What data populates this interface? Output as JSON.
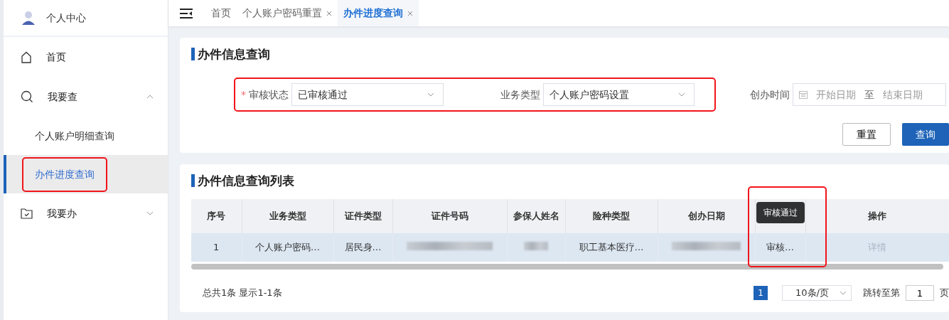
{
  "sidebar": {
    "user": {
      "name": "个人中心"
    },
    "items": [
      {
        "label": "首页"
      },
      {
        "label": "我要查",
        "expanded": true,
        "children": [
          {
            "label": "个人账户明细查询",
            "selected": false,
            "annotated": false
          },
          {
            "label": "办件进度查询",
            "selected": true,
            "annotated": true
          }
        ]
      },
      {
        "label": "我要办",
        "expanded": false
      }
    ]
  },
  "tabs": [
    {
      "label": "首页",
      "selected": false,
      "closable": false
    },
    {
      "label": "个人账户密码重置",
      "selected": false,
      "closable": true
    },
    {
      "label": "办件进度查询",
      "selected": true,
      "closable": true
    }
  ],
  "query": {
    "title": "办件信息查询",
    "fields": [
      {
        "label": "审核状态",
        "required_mark": "*",
        "value": "已审核通过"
      },
      {
        "label": "业务类型",
        "value": "个人账户密码设置"
      }
    ],
    "fields_annotated": true,
    "date": {
      "label": "创办时间",
      "start_placeholder": "开始日期",
      "separator": "至",
      "end_placeholder": "结束日期"
    },
    "buttons": [
      {
        "label": "重置",
        "primary": false
      },
      {
        "label": "查询",
        "primary": true
      }
    ]
  },
  "results": {
    "title": "办件信息查询列表",
    "columns": [
      {
        "label": "序号",
        "annotated": false
      },
      {
        "label": "业务类型",
        "annotated": false
      },
      {
        "label": "证件类型",
        "annotated": false
      },
      {
        "label": "证件号码",
        "annotated": false
      },
      {
        "label": "参保人姓名",
        "annotated": false
      },
      {
        "label": "险种类型",
        "annotated": false
      },
      {
        "label": "创办日期",
        "annotated": false
      },
      {
        "annotated": true
      },
      {
        "label": "操作",
        "annotated": false
      }
    ],
    "rows": [
      {
        "cells": [
          {
            "kind": "text",
            "text": "1"
          },
          {
            "kind": "text",
            "text": "个人账户密码…"
          },
          {
            "kind": "text",
            "text": "居民身…"
          },
          {
            "kind": "masked"
          },
          {
            "kind": "masked"
          },
          {
            "kind": "text",
            "text": "职工基本医疗…"
          },
          {
            "kind": "masked"
          },
          {
            "kind": "text",
            "text": "审核…"
          },
          {
            "kind": "link",
            "text": "详情",
            "disabled": true
          }
        ]
      }
    ],
    "tooltip": "审核通过",
    "summary": "总共1条 显示1-1条",
    "pages": [
      {
        "label": "1",
        "selected": true
      }
    ],
    "page_size": "10条/页",
    "jump": {
      "label": "跳转至第",
      "value": "1",
      "suffix": "页"
    }
  }
}
